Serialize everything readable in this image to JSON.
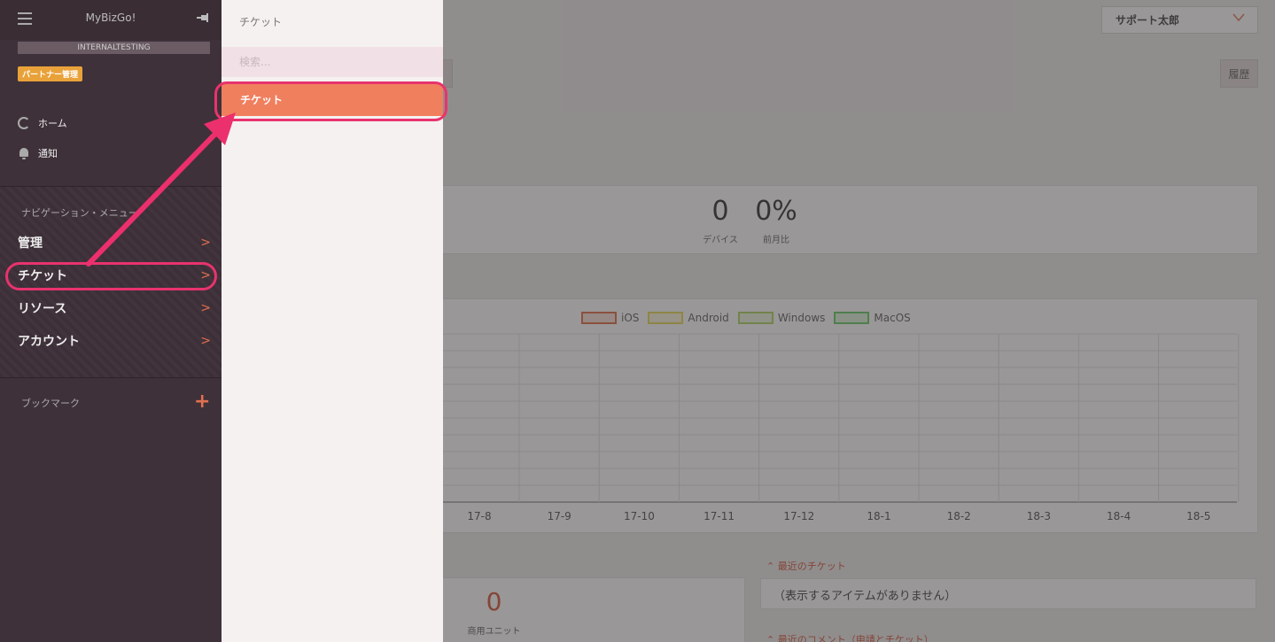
{
  "app": {
    "brand": "MyBizGo!",
    "environment": "INTERNALTESTING",
    "partner_badge": "パートナー管理"
  },
  "header": {
    "user_name": "サポート太郎",
    "history_label": "履歴"
  },
  "sidebar": {
    "home_label": "ホーム",
    "notify_label": "通知",
    "nav_heading": "ナビゲーション・メニュー",
    "items": [
      {
        "label": "管理"
      },
      {
        "label": "チケット"
      },
      {
        "label": "リソース"
      },
      {
        "label": "アカウント"
      }
    ],
    "bookmark_label": "ブックマーク",
    "bookmark_add": "+"
  },
  "submenu": {
    "title": "チケット",
    "search_placeholder": "検索...",
    "items": [
      {
        "label": "チケット"
      }
    ]
  },
  "stats": [
    {
      "value": "0",
      "label": "デバイス"
    },
    {
      "value": "0%",
      "label": "前月比"
    }
  ],
  "chart_data": {
    "type": "line",
    "series": [
      {
        "name": "iOS",
        "color": "#e0623c",
        "values": []
      },
      {
        "name": "Android",
        "color": "#e6d84a",
        "values": []
      },
      {
        "name": "Windows",
        "color": "#a9d35a",
        "values": []
      },
      {
        "name": "MacOS",
        "color": "#5cc85c",
        "values": []
      }
    ],
    "categories": [
      "17-8",
      "17-9",
      "17-10",
      "17-11",
      "17-12",
      "18-1",
      "18-2",
      "18-3",
      "18-4",
      "18-5"
    ],
    "legend_position": "top",
    "grid": true
  },
  "units": {
    "value": "0",
    "label": "商用ユニット"
  },
  "recent_tickets": {
    "title": "最近のチケット",
    "empty": "（表示するアイテムがありません）"
  },
  "recent_comments": {
    "title": "最近のコメント（申請とチケット）"
  },
  "colors": {
    "accent": "#f07f5e",
    "highlight": "#e8336e",
    "sidebar": "#3f3139"
  }
}
